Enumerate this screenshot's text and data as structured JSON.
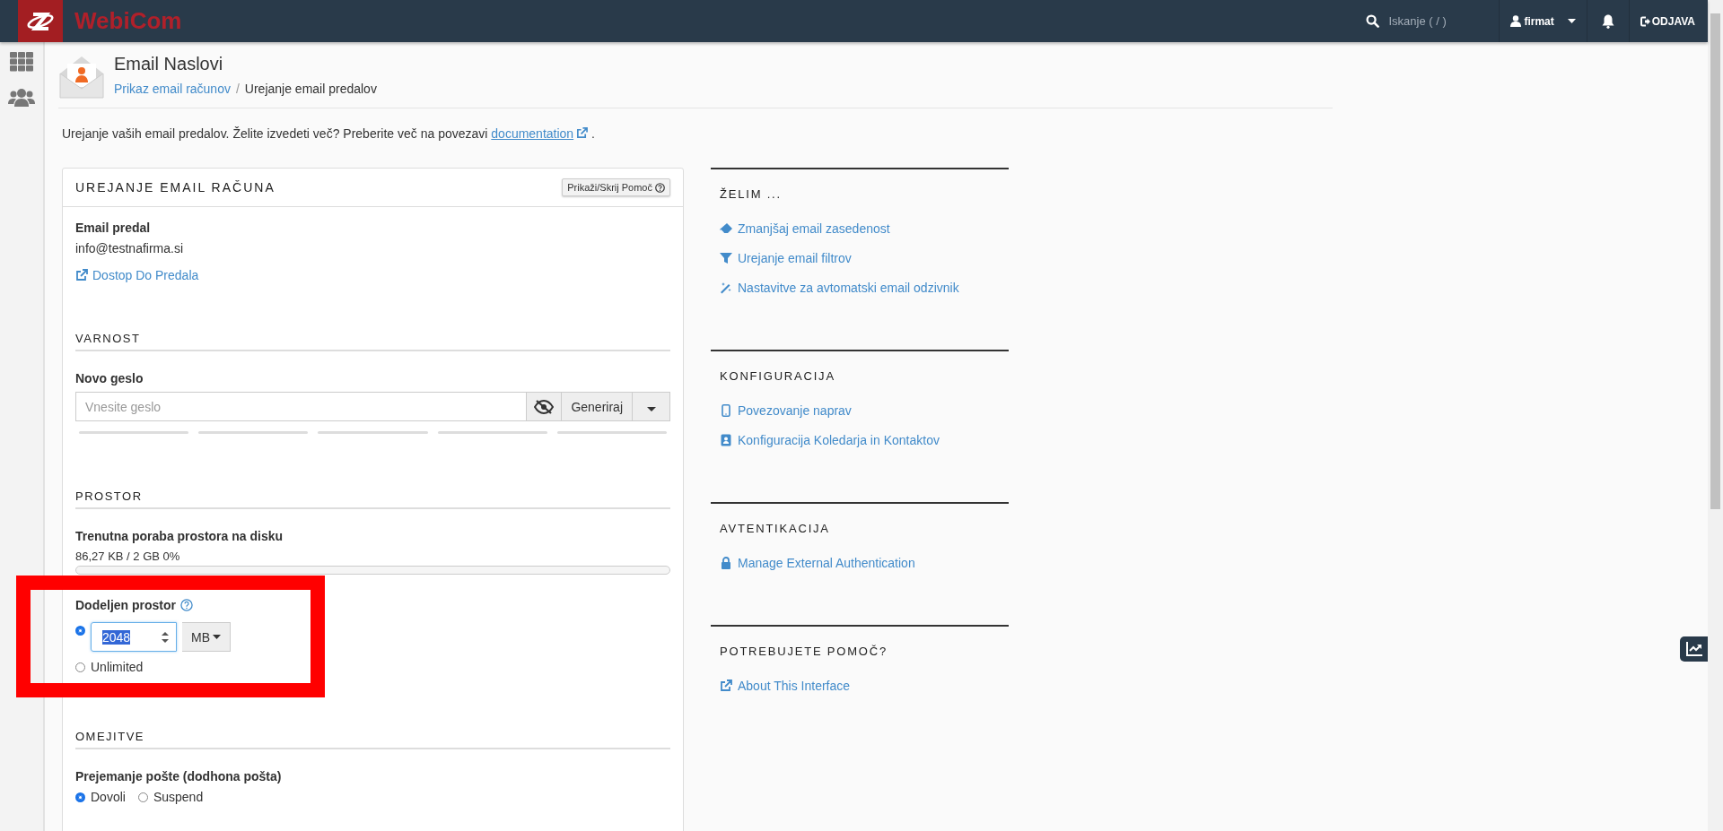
{
  "topbar": {
    "logo_text": "WebiCom",
    "search": {
      "placeholder": "Iskanje ( / )"
    },
    "user": "firmat",
    "logout": "ODJAVA"
  },
  "page": {
    "title": "Email Naslovi",
    "breadcrumb": [
      {
        "label": "Prikaz email računov",
        "kind": "link"
      },
      {
        "label": "Urejanje email predalov",
        "kind": "current",
        "separator": "/"
      }
    ],
    "description": {
      "text": "Urejanje vaših email predalov. Želite izvedeti več? Preberite več na povezavi",
      "link": "documentation",
      "end": "."
    }
  },
  "panel": {
    "title": "UREJANJE EMAIL RAČUNA",
    "help_button": "Prikaži/Skrij Pomoč",
    "mailbox": {
      "label": "Email predal",
      "value": "info@testnafirma.si",
      "link": "Dostop Do Predala"
    },
    "security": {
      "heading": "VARNOST",
      "label": "Novo geslo",
      "placeholder": "Vnesite geslo",
      "generate_button": "Generiraj"
    },
    "space": {
      "heading": "PROSTOR",
      "usage_label": "Trenutna poraba prostora na disku",
      "usage_text": "86,27 KB / 2 GB 0%",
      "level": 0,
      "quota_label": "Dodeljen prostor",
      "quota_options": [
        {
          "kind": "number",
          "value": "2048",
          "unit": "MB",
          "selected": true
        },
        {
          "kind": "text",
          "label": "Unlimited",
          "selected": false
        }
      ]
    },
    "limits": {
      "heading": "OMEJITVE",
      "label": "Prejemanje pošte (dodhona pošta)",
      "options": [
        {
          "label": "Dovoli",
          "selected": true
        },
        {
          "label": "Suspend",
          "selected": false
        }
      ]
    }
  },
  "side_sections": [
    {
      "title": "ŽELIM ...",
      "links": [
        {
          "label": "Zmanjšaj email zasedenost"
        },
        {
          "label": "Urejanje email filtrov"
        },
        {
          "label": "Nastavitve za avtomatski email odzivnik"
        }
      ]
    },
    {
      "title": "KONFIGURACIJA",
      "links": [
        {
          "label": "Povezovanje naprav"
        },
        {
          "label": "Konfiguracija Koledarja in Kontaktov"
        }
      ]
    },
    {
      "title": "AVTENTIKACIJA",
      "links": [
        {
          "label": "Manage External Authentication"
        }
      ]
    },
    {
      "title": "POTREBUJETE POMOČ?",
      "links": [
        {
          "label": "About This Interface"
        }
      ]
    }
  ]
}
